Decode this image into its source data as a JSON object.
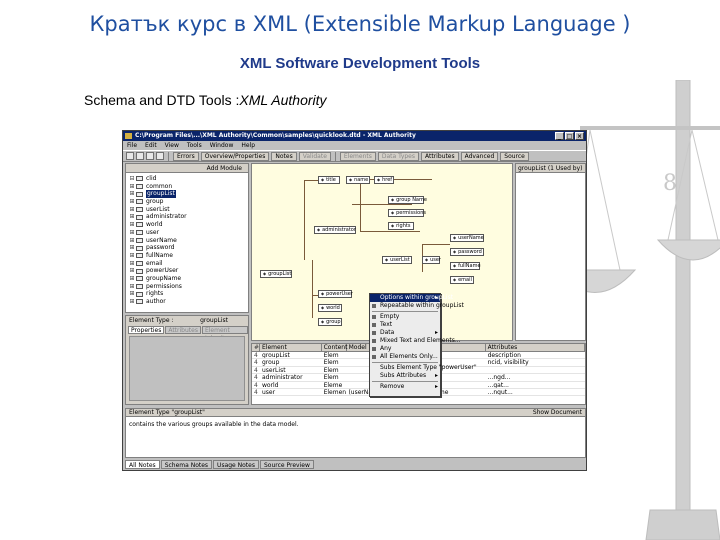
{
  "slide": {
    "title": "Кратък курс в XML (Extensible Markup Language )",
    "subtitle": "XML Software Development Tools",
    "caption_prefix": "Schema and DTD Tools :",
    "caption_product": "XML Authority"
  },
  "app": {
    "title": "C:\\Program Files\\...\\XML Authority\\Common\\samples\\quicklook.dtd - XML Authority",
    "window_buttons": [
      "_",
      "□",
      "×"
    ],
    "menu": [
      "File",
      "Edit",
      "View",
      "Tools",
      "Window",
      "Help"
    ],
    "toolbar": {
      "errors": "Errors",
      "overview": "Overview/Properties",
      "notes": "Notes",
      "validate": "Validate",
      "elements": "Elements",
      "data_types": "Data Types",
      "attributes": "Attributes",
      "advanced": "Advanced",
      "source": "Source"
    },
    "left_pane": {
      "header": "Add Module",
      "tree": [
        {
          "twisty": "⊟",
          "label": "clid"
        },
        {
          "twisty": "⊞",
          "label": "common"
        },
        {
          "twisty": "⊞",
          "label": "groupList",
          "selected": true
        },
        {
          "twisty": "⊞",
          "label": "group"
        },
        {
          "twisty": "⊞",
          "label": "userList"
        },
        {
          "twisty": "⊞",
          "label": "administrator"
        },
        {
          "twisty": "⊞",
          "label": "world"
        },
        {
          "twisty": "⊞",
          "label": "user"
        },
        {
          "twisty": "⊞",
          "label": "userName"
        },
        {
          "twisty": "⊞",
          "label": "password"
        },
        {
          "twisty": "⊞",
          "label": "fullName"
        },
        {
          "twisty": "⊞",
          "label": "email"
        },
        {
          "twisty": "⊞",
          "label": "powerUser"
        },
        {
          "twisty": "⊞",
          "label": "groupName"
        },
        {
          "twisty": "⊞",
          "label": "permissions"
        },
        {
          "twisty": "⊞",
          "label": "rights"
        },
        {
          "twisty": "⊞",
          "label": "author"
        }
      ]
    },
    "properties": {
      "label": "Element Type :",
      "value": "groupList",
      "tabs": [
        "Properties",
        "Attributes",
        "Element Inherit"
      ]
    },
    "diagram_nodes": [
      {
        "name": "title"
      },
      {
        "name": "name"
      },
      {
        "name": "href"
      },
      {
        "name": "group Name"
      },
      {
        "name": "permissions"
      },
      {
        "name": "rights"
      },
      {
        "name": "administrator"
      },
      {
        "name": "userName"
      },
      {
        "name": "password"
      },
      {
        "name": "userList"
      },
      {
        "name": "user"
      },
      {
        "name": "fullName"
      },
      {
        "name": "email"
      },
      {
        "name": "groupList"
      },
      {
        "name": "powerUser"
      },
      {
        "name": "world"
      },
      {
        "name": "group"
      }
    ],
    "right_pane": {
      "header": "groupList (1 Used by)"
    },
    "context_menu": [
      {
        "label": "Options within groupList",
        "arrow": "▸",
        "highlight": true
      },
      {
        "label": "Repeatable within groupList",
        "check": true
      },
      {
        "sep": true
      },
      {
        "label": "Empty",
        "mark": true
      },
      {
        "label": "Text",
        "mark": true
      },
      {
        "label": "Data",
        "arrow": "▸",
        "mark": true
      },
      {
        "label": "Mixed Text and Elements...",
        "mark": true
      },
      {
        "label": "Any",
        "mark": true
      },
      {
        "label": "All Elements Only...",
        "check": true
      },
      {
        "sep": true
      },
      {
        "label": "Subs Element Type \"powerUser\""
      },
      {
        "label": "Subs Attributes",
        "arrow": "▸"
      },
      {
        "sep": true
      },
      {
        "label": "Remove",
        "arrow": "▸"
      }
    ],
    "grid": {
      "headers": [
        "#",
        "Element",
        "Content",
        "Model",
        "Attributes"
      ],
      "rows": [
        {
          "n": "4",
          "element": "groupList",
          "content": "Elem",
          "model": "",
          "attrs": "description"
        },
        {
          "n": "4",
          "element": "group",
          "content": "Elem",
          "model": "",
          "attrs": "ncid, visibility"
        },
        {
          "n": "4",
          "element": "userList",
          "content": "Elem",
          "model": "",
          "attrs": ""
        },
        {
          "n": "4",
          "element": "administrator",
          "content": "Elem",
          "model": "",
          "attrs": "...ngd..."
        },
        {
          "n": "4",
          "element": "world",
          "content": "Eleme",
          "model": "",
          "attrs": "...gat..."
        },
        {
          "n": "4",
          "element": "user",
          "content": "Elements",
          "model": "(userName , password , fullName",
          "attrs": "...ngut..."
        }
      ]
    },
    "document": {
      "header_left": "Element Type \"groupList\"",
      "header_right": "Show Document",
      "text": "contains the various groups available in the data model."
    },
    "bottom_tabs": [
      "All Notes",
      "Schema Notes",
      "Usage Notes",
      "Source Preview"
    ]
  },
  "colors": {
    "title": "#1f4fa0",
    "subtitle": "#1f3a8a",
    "titlebar": "#0a246a",
    "diagram_bg": "#fffde0"
  }
}
